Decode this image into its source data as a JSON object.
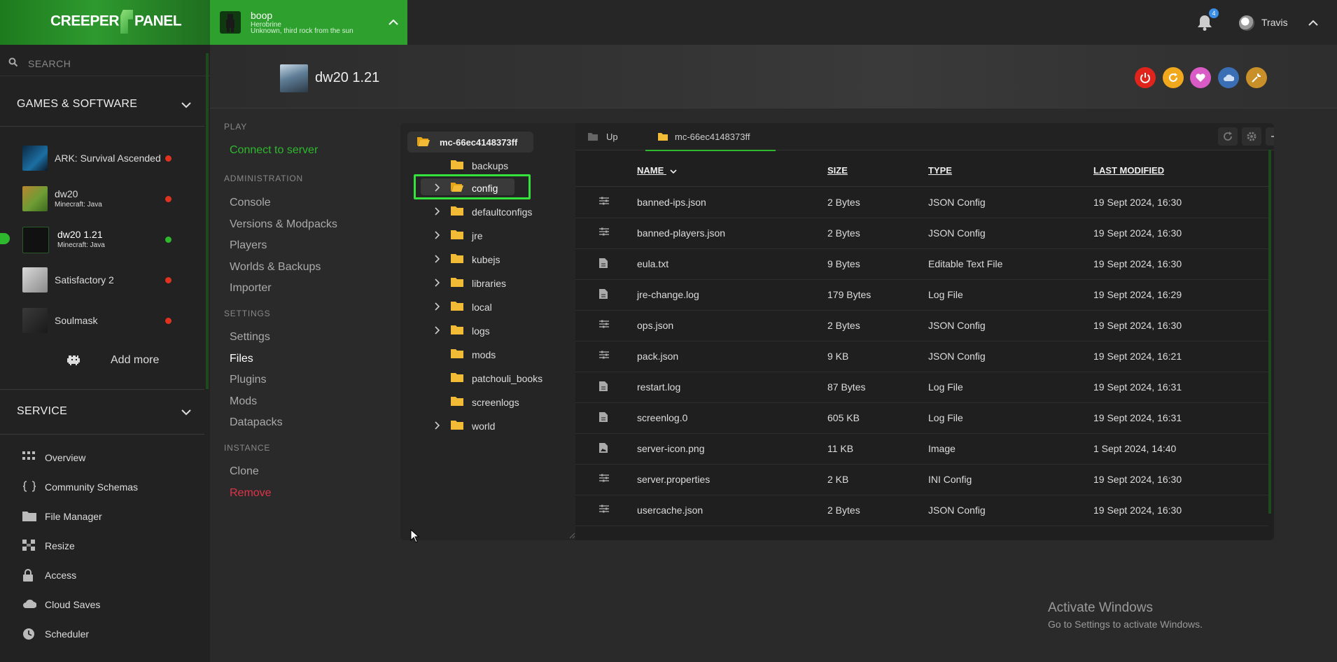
{
  "app": {
    "logo_left": "CREEPER",
    "logo_right": "PANEL"
  },
  "search": {
    "placeholder": "SEARCH"
  },
  "sidebar": {
    "games_heading": "GAMES & SOFTWARE",
    "games": [
      {
        "name": "ARK: Survival Ascended",
        "sub": "",
        "status": "offline",
        "status_color": "#e0331f"
      },
      {
        "name": "dw20",
        "sub": "Minecraft: Java",
        "status": "offline",
        "status_color": "#e0331f"
      },
      {
        "name": "dw20 1.21",
        "sub": "Minecraft: Java",
        "status": "online",
        "status_color": "#2eb82e"
      },
      {
        "name": "Satisfactory 2",
        "sub": "",
        "status": "offline",
        "status_color": "#e0331f"
      },
      {
        "name": "Soulmask",
        "sub": "",
        "status": "offline",
        "status_color": "#e0331f"
      }
    ],
    "add_more": "Add more",
    "service_heading": "SERVICE",
    "service_items": [
      {
        "label": "Overview",
        "icon": "grid-icon"
      },
      {
        "label": "Community Schemas",
        "icon": "braces-icon"
      },
      {
        "label": "File Manager",
        "icon": "folder-icon"
      },
      {
        "label": "Resize",
        "icon": "resize-icon"
      },
      {
        "label": "Access",
        "icon": "lock-icon"
      },
      {
        "label": "Cloud Saves",
        "icon": "cloud-icon"
      },
      {
        "label": "Scheduler",
        "icon": "clock-icon"
      }
    ]
  },
  "topbar": {
    "server_name": "boop",
    "server_line2": "Herobrine",
    "server_line3": "Unknown, third rock from the sun",
    "notification_count": "4",
    "user_name": "Travis"
  },
  "server": {
    "title": "dw20 1.21"
  },
  "nav": {
    "play_heading": "PLAY",
    "connect": "Connect to server",
    "admin_heading": "ADMINISTRATION",
    "admin_items": [
      "Console",
      "Versions & Modpacks",
      "Players",
      "Worlds & Backups",
      "Importer"
    ],
    "settings_heading": "SETTINGS",
    "settings_items": [
      "Settings",
      "Files",
      "Plugins",
      "Mods",
      "Datapacks"
    ],
    "instance_heading": "INSTANCE",
    "clone": "Clone",
    "remove": "Remove"
  },
  "file_manager": {
    "root": "mc-66ec4148373ff",
    "tabs": {
      "up": "Up",
      "current": "mc-66ec4148373ff"
    },
    "tree": [
      {
        "name": "backups",
        "expandable": false
      },
      {
        "name": "config",
        "expandable": true
      },
      {
        "name": "defaultconfigs",
        "expandable": true
      },
      {
        "name": "jre",
        "expandable": true
      },
      {
        "name": "kubejs",
        "expandable": true
      },
      {
        "name": "libraries",
        "expandable": true
      },
      {
        "name": "local",
        "expandable": true
      },
      {
        "name": "logs",
        "expandable": true
      },
      {
        "name": "mods",
        "expandable": false
      },
      {
        "name": "patchouli_books",
        "expandable": false
      },
      {
        "name": "screenlogs",
        "expandable": false
      },
      {
        "name": "world",
        "expandable": true
      }
    ],
    "columns": {
      "name": "NAME",
      "size": "SIZE",
      "type": "TYPE",
      "modified": "LAST MODIFIED"
    },
    "files": [
      {
        "name": "banned-ips.json",
        "size": "2 Bytes",
        "type": "JSON Config",
        "modified": "19 Sept 2024, 16:30",
        "icon": "settings-lines-icon"
      },
      {
        "name": "banned-players.json",
        "size": "2 Bytes",
        "type": "JSON Config",
        "modified": "19 Sept 2024, 16:30",
        "icon": "settings-lines-icon"
      },
      {
        "name": "eula.txt",
        "size": "9 Bytes",
        "type": "Editable Text File",
        "modified": "19 Sept 2024, 16:30",
        "icon": "document-icon"
      },
      {
        "name": "jre-change.log",
        "size": "179 Bytes",
        "type": "Log File",
        "modified": "19 Sept 2024, 16:29",
        "icon": "document-icon"
      },
      {
        "name": "ops.json",
        "size": "2 Bytes",
        "type": "JSON Config",
        "modified": "19 Sept 2024, 16:30",
        "icon": "settings-lines-icon"
      },
      {
        "name": "pack.json",
        "size": "9 KB",
        "type": "JSON Config",
        "modified": "19 Sept 2024, 16:21",
        "icon": "settings-lines-icon"
      },
      {
        "name": "restart.log",
        "size": "87 Bytes",
        "type": "Log File",
        "modified": "19 Sept 2024, 16:31",
        "icon": "document-icon"
      },
      {
        "name": "screenlog.0",
        "size": "605 KB",
        "type": "Log File",
        "modified": "19 Sept 2024, 16:31",
        "icon": "document-icon"
      },
      {
        "name": "server-icon.png",
        "size": "11 KB",
        "type": "Image",
        "modified": "1 Sept 2024, 14:40",
        "icon": "image-file-icon"
      },
      {
        "name": "server.properties",
        "size": "2 KB",
        "type": "INI Config",
        "modified": "19 Sept 2024, 16:30",
        "icon": "settings-lines-icon"
      },
      {
        "name": "usercache.json",
        "size": "2 Bytes",
        "type": "JSON Config",
        "modified": "19 Sept 2024, 16:30",
        "icon": "settings-lines-icon"
      }
    ]
  },
  "watermark": {
    "line1": "Activate Windows",
    "line2": "Go to Settings to activate Windows."
  },
  "colors": {
    "accent": "#2eb82e",
    "danger": "#e0331f",
    "highlight": "#35e13c"
  }
}
